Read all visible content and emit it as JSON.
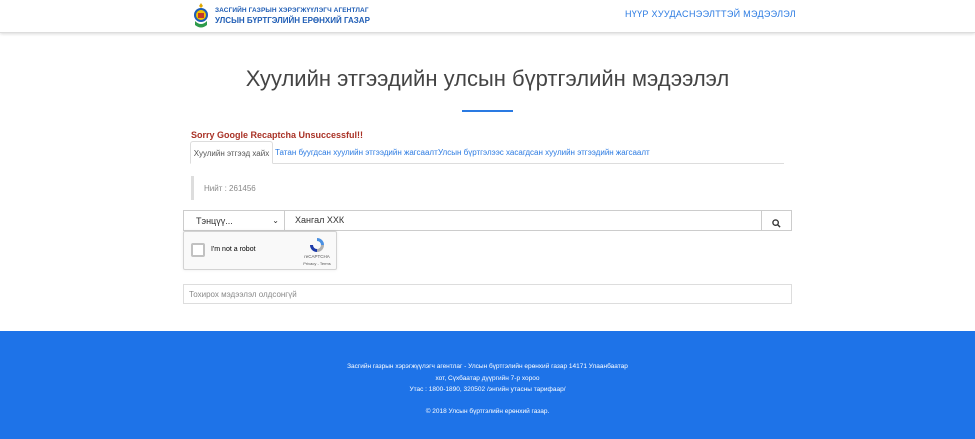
{
  "header": {
    "agency_line1": "ЗАСГИЙН ГАЗРЫН ХЭРЭГЖҮҮЛЭГЧ АГЕНТЛАГ",
    "agency_line2": "УЛСЫН БҮРТГЭЛИЙН ЕРӨНХИЙ ГАЗАР",
    "nav": [
      {
        "label": "НҮҮР ХУУДАС"
      },
      {
        "label": "НЭЭЛТТЭЙ МЭДЭЭЛЭЛ"
      }
    ]
  },
  "main": {
    "title": "Хуулийн этгээдийн улсын бүртгэлийн мэдээлэл",
    "error": "Sorry Google Recaptcha Unsuccessful!!",
    "tabs": [
      {
        "label": "Хуулийн этгээд хайх",
        "active": true
      },
      {
        "label": "Татан буугдсан хуулийн этгээдийн жагсаалт",
        "active": false
      },
      {
        "label": "Улсын бүртгэлээс хасагдсан хуулийн этгээдийн жагсаалт",
        "active": false
      }
    ],
    "total": "Нийт : 261456",
    "search": {
      "select_value": "Тэнцүү...",
      "input_value": "Хангал ХХК"
    },
    "recaptcha": {
      "label": "I'm not a robot",
      "brand": "reCAPTCHA",
      "terms": "Privacy - Terms"
    },
    "result": "Тохирох мэдээлэл олдсонгүй"
  },
  "footer": {
    "line1": "Засгийн газрын хэрэгжүүлэгч агентлаг - Улсын бүртгэлийн ерөнхий газар 14171 Улаанбаатар",
    "line2": "хот, Сүхбаатар дүүргийн 7-р хороо",
    "line3": "Утас : 1800-1890, 320502 /энгийн утасны тарифаар/",
    "copyright": "© 2018 Улсын бүртгэлийн ерөнхий газар."
  },
  "colors": {
    "accent": "#2a7ae2",
    "footer_bg": "#1e73e8",
    "error": "#a93226"
  }
}
